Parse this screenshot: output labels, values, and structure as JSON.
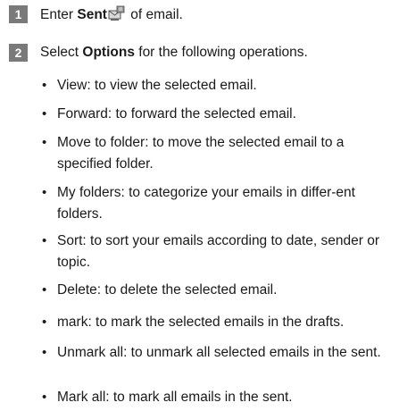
{
  "step1": {
    "number": "1",
    "prefix": "Enter ",
    "bold": "Sent",
    "icon": "sent-mailbox-icon",
    "suffix": " of email."
  },
  "step2": {
    "number": "2",
    "prefix": "Select ",
    "bold": "Options",
    "suffix": " for the following operations."
  },
  "bullets": [
    "View: to view the selected email.",
    "Forward: to forward the selected email.",
    "Move to folder: to move the selected email to a specified folder.",
    "My folders: to categorize your emails in differ-ent folders.",
    "Sort: to sort your emails according to date, sender or topic.",
    "Delete: to delete the selected email.",
    "mark: to mark the selected emails in the drafts.",
    "Unmark all: to unmark all selected emails in the sent.",
    "Mark all: to mark all emails in the sent."
  ],
  "colors": {
    "badge": "#7a7a7a",
    "text": "#1a1a1a"
  }
}
